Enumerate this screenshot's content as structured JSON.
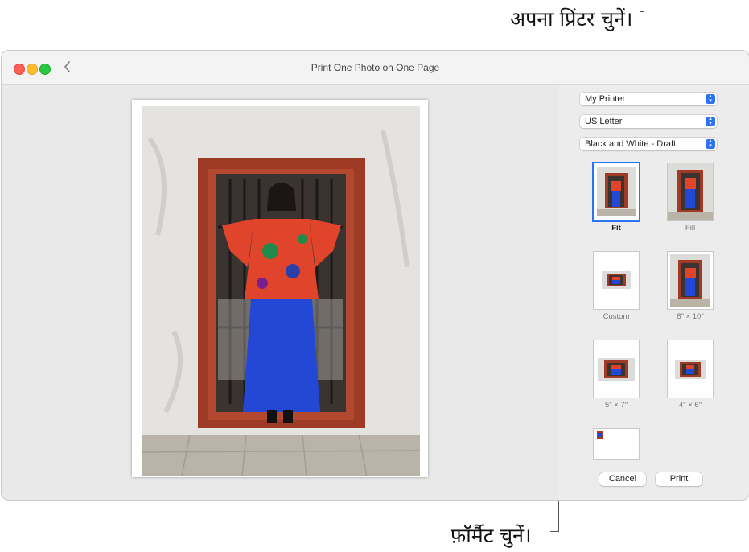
{
  "callouts": {
    "printer": "अपना प्रिंटर चुनें।",
    "format": "फ़ॉर्मैट चुनें।"
  },
  "window": {
    "title": "Print One Photo on One Page"
  },
  "popups": {
    "printer": "My Printer",
    "paper_size": "US Letter",
    "quality": "Black and White - Draft"
  },
  "formats": [
    {
      "label": "Fit",
      "selected": true
    },
    {
      "label": "Fill",
      "selected": false
    },
    {
      "label": "Custom",
      "selected": false
    },
    {
      "label": "8″ × 10″",
      "selected": false
    },
    {
      "label": "5″ × 7″",
      "selected": false
    },
    {
      "label": "4″ × 6″",
      "selected": false
    },
    {
      "label": "",
      "selected": false
    }
  ],
  "buttons": {
    "cancel": "Cancel",
    "print": "Print"
  },
  "colors": {
    "accent": "#2b72f5",
    "close": "#fe5f57",
    "minimize": "#febc2e",
    "zoom": "#28c840"
  }
}
